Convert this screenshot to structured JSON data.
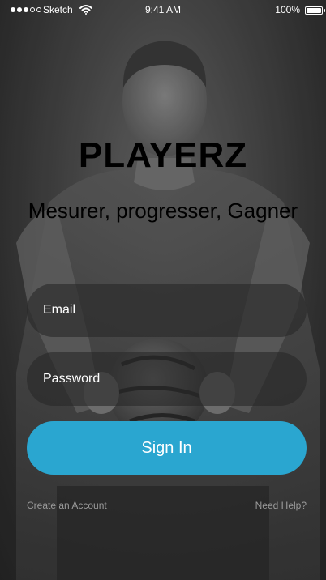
{
  "status_bar": {
    "carrier": "Sketch",
    "time": "9:41 AM",
    "battery": "100%",
    "battery_level": 1.0,
    "signal_bars_filled": 3,
    "signal_bars_total": 5,
    "icons": [
      "signal-dots-icon",
      "wifi-icon",
      "battery-icon"
    ]
  },
  "app": {
    "title": "PLAYERZ",
    "tagline": "Mesurer, progresser, Gagner"
  },
  "login": {
    "email_placeholder": "Email",
    "password_placeholder": "Password",
    "sign_in_label": "Sign In",
    "create_account_label": "Create an Account",
    "need_help_label": "Need Help?"
  },
  "colors": {
    "accent": "#2aa6d0",
    "field_background": "#282828",
    "link": "#9a9a9a",
    "title": "#000000"
  }
}
